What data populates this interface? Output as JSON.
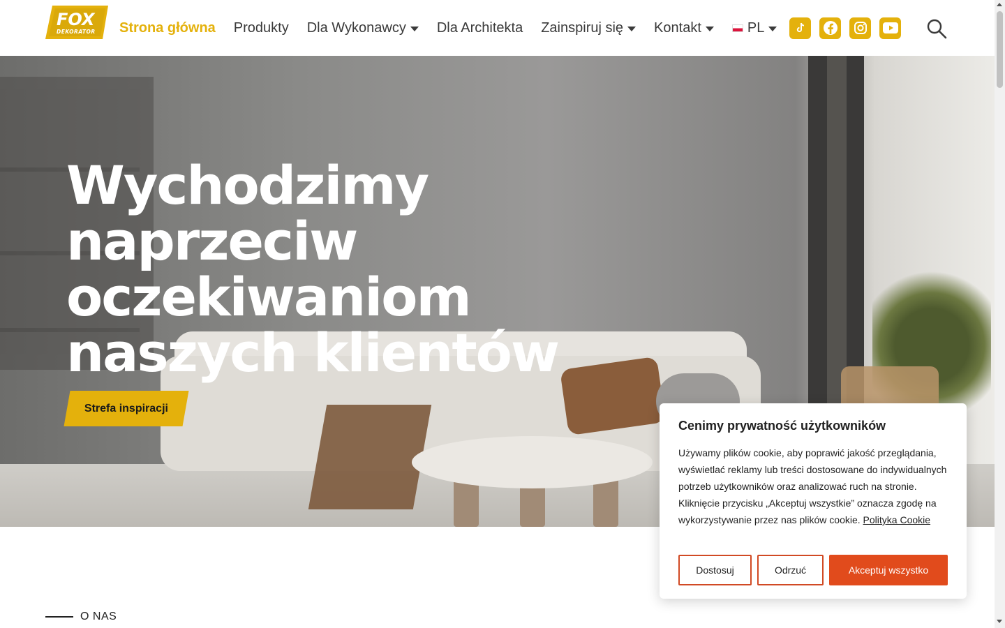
{
  "brand": {
    "logo_top": "FOX",
    "logo_bottom": "DEKORATOR"
  },
  "nav": {
    "items": [
      {
        "label": "Strona główna",
        "active": true,
        "dropdown": false
      },
      {
        "label": "Produkty",
        "active": false,
        "dropdown": false
      },
      {
        "label": "Dla Wykonawcy",
        "active": false,
        "dropdown": true
      },
      {
        "label": "Dla Architekta",
        "active": false,
        "dropdown": false
      },
      {
        "label": "Zainspiruj się",
        "active": false,
        "dropdown": true
      },
      {
        "label": "Kontakt",
        "active": false,
        "dropdown": true
      }
    ],
    "language": "PL",
    "social": [
      "tiktok-icon",
      "facebook-icon",
      "instagram-icon",
      "youtube-icon"
    ],
    "accent_color": "#e4b10c"
  },
  "hero": {
    "title_lines": [
      "Wychodzimy",
      "naprzeciw",
      "oczekiwaniom",
      "naszych klientów"
    ],
    "cta_label": "Strefa inspiracji"
  },
  "section": {
    "eyebrow": "O NAS"
  },
  "cookie": {
    "title": "Cenimy prywatność użytkowników",
    "body": "Używamy plików cookie, aby poprawić jakość przeglądania, wyświetlać reklamy lub treści dostosowane do indywidualnych potrzeb użytkowników oraz analizować ruch na stronie. Kliknięcie przycisku „Akceptuj wszystkie” oznacza zgodę na wykorzystywanie przez nas plików cookie.",
    "link_label": "Polityka Cookie",
    "buttons": {
      "customize": "Dostosuj",
      "reject": "Odrzuć",
      "accept": "Akceptuj wszystko"
    },
    "accent_color": "#e14b1c"
  }
}
